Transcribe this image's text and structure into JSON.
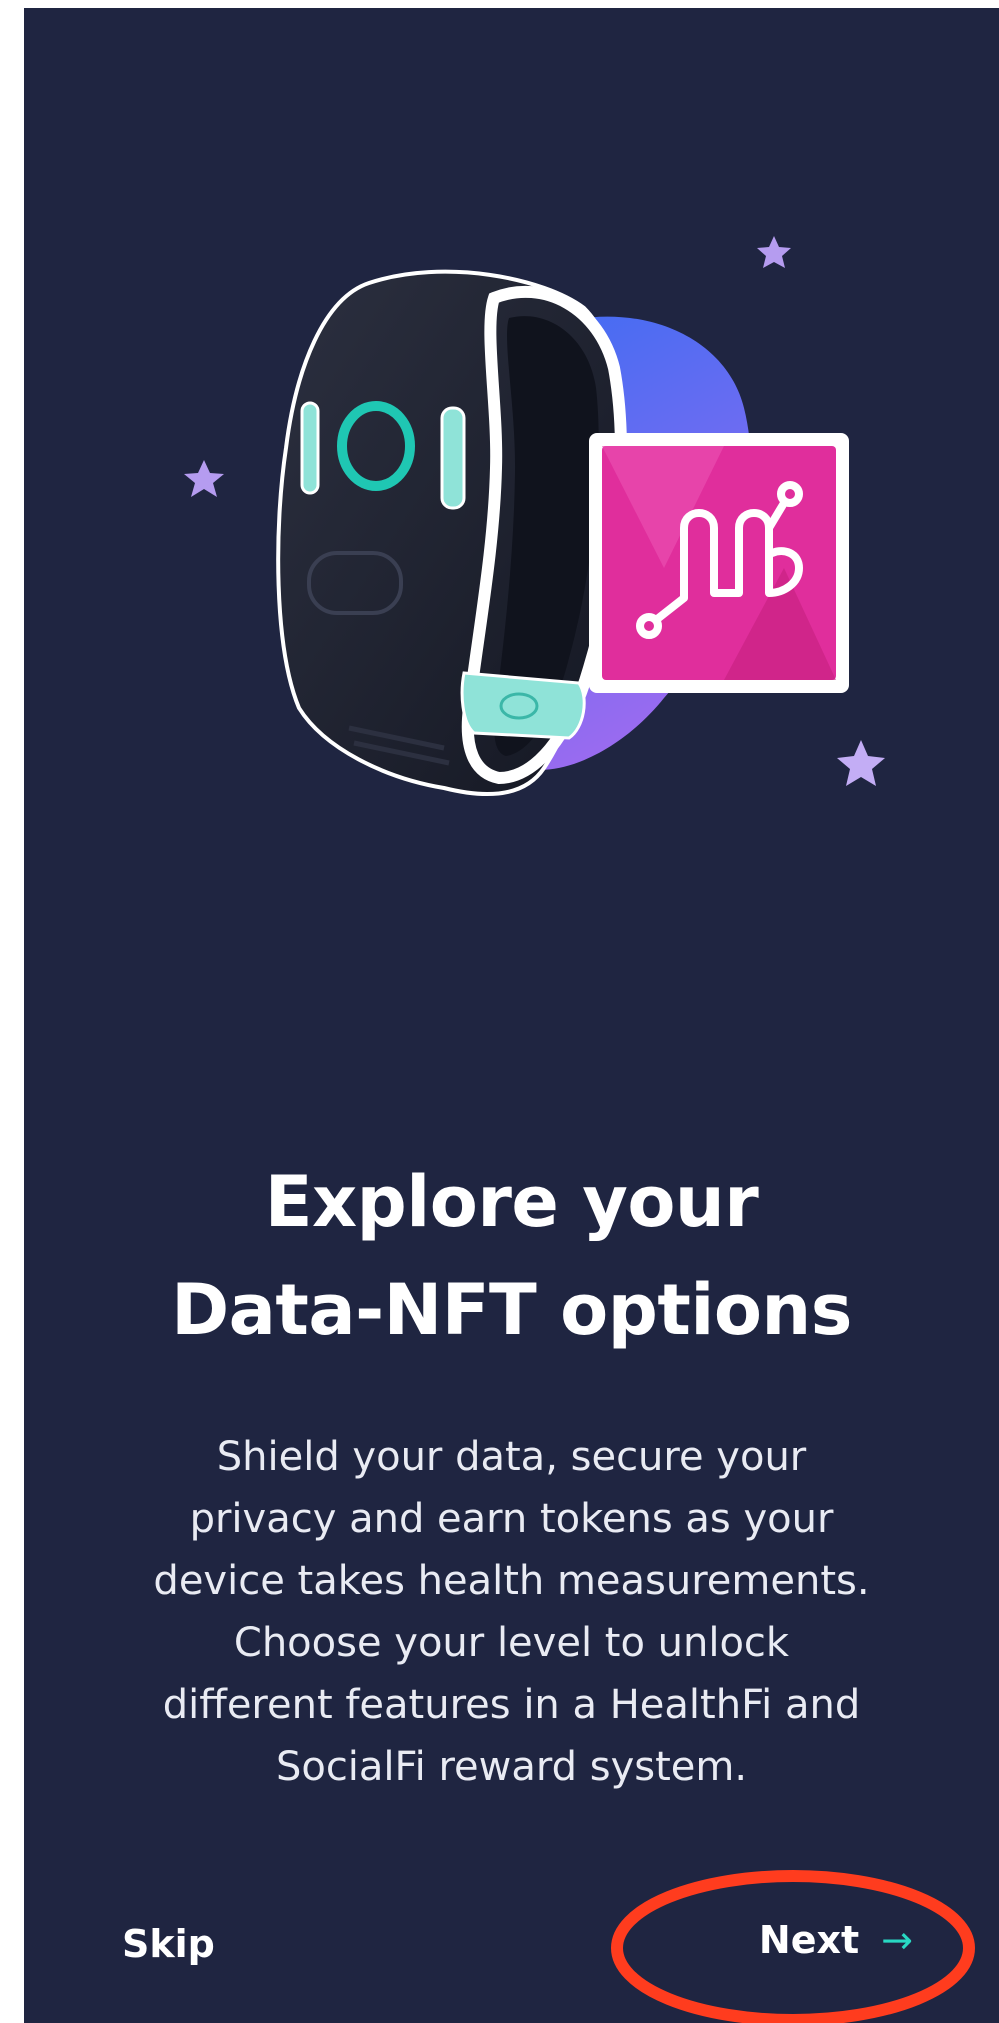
{
  "onboarding": {
    "title_lines": [
      "Explore your",
      "Data-NFT options"
    ],
    "description_lines": [
      "Shield your data, secure your",
      "privacy and earn tokens as your",
      "device takes health measurements.",
      "Choose your level to unlock",
      "different features in a HealthFi and",
      "SocialFi reward system."
    ]
  },
  "footer": {
    "skip_label": "Skip",
    "next_label": "Next",
    "next_icon": "arrow-right-icon"
  },
  "colors": {
    "background": "#1f2541",
    "accent_teal": "#28d8c3",
    "nft_pink": "#e02e9c",
    "star_purple": "#b59cf0",
    "highlight_red": "#ff3c1e"
  }
}
